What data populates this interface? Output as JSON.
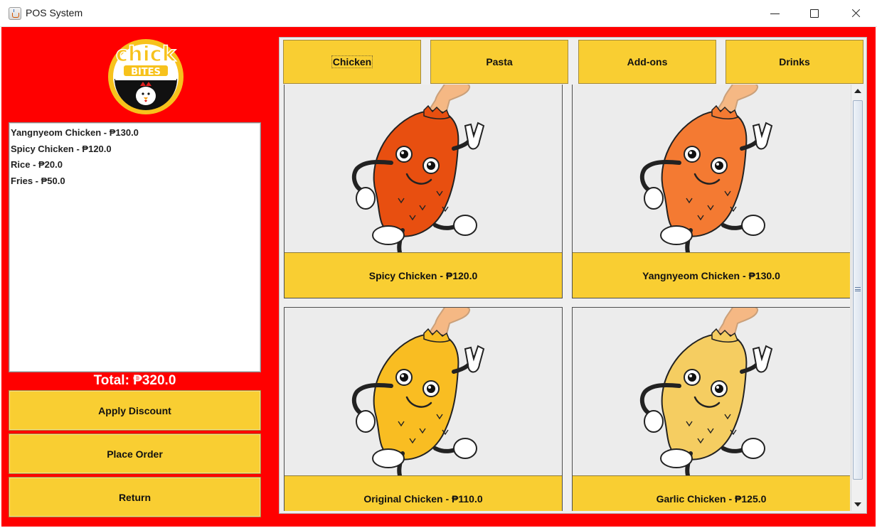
{
  "window": {
    "title": "POS System"
  },
  "logo": {
    "line1": "chick",
    "line2": "BITES"
  },
  "order": {
    "items": [
      "Yangnyeom Chicken - ₱130.0",
      "Spicy Chicken - ₱120.0",
      "Rice - ₱20.0",
      "Fries - ₱50.0"
    ],
    "total": "Total: ₱320.0"
  },
  "actions": {
    "apply_discount": "Apply Discount",
    "place_order": "Place Order",
    "return": "Return"
  },
  "tabs": [
    {
      "label": "Chicken",
      "active": true
    },
    {
      "label": "Pasta"
    },
    {
      "label": "Add-ons"
    },
    {
      "label": "Drinks"
    }
  ],
  "menu_items": [
    {
      "label": "Spicy Chicken - ₱120.0",
      "color": "#e84f10"
    },
    {
      "label": "Yangnyeom Chicken - ₱130.0",
      "color": "#f47a32"
    },
    {
      "label": "Original Chicken - ₱110.0",
      "color": "#f9bd22"
    },
    {
      "label": "Garlic Chicken - ₱125.0",
      "color": "#f5cd61"
    }
  ],
  "colors": {
    "background": "#ff0000",
    "button": "#f9ce32",
    "panel": "#efefef"
  },
  "icons": {
    "app": "java-cup-icon",
    "minimize": "minimize-icon",
    "maximize": "maximize-icon",
    "close": "close-icon",
    "scroll_up": "arrow-up-icon",
    "scroll_down": "arrow-down-icon"
  }
}
